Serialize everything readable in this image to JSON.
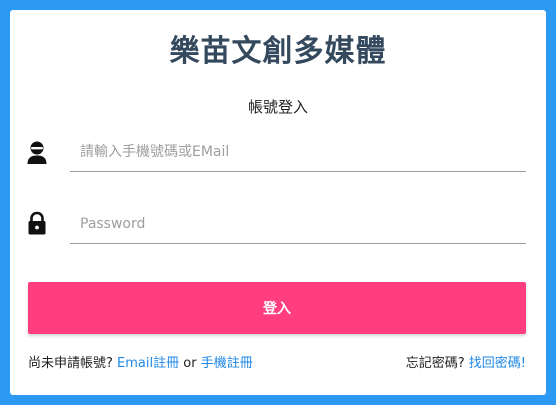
{
  "page": {
    "background_color": "#2c9af2",
    "card_color": "#ffffff"
  },
  "header": {
    "brand_title": "樂苗文創多媒體"
  },
  "login": {
    "section_title": "帳號登入",
    "account_field": {
      "icon": "user-icon",
      "value": "",
      "placeholder": "請輸入手機號碼或EMail"
    },
    "password_field": {
      "icon": "lock-icon",
      "value": "",
      "placeholder": "Password"
    },
    "submit_label": "登入",
    "submit_color": "#ff3d7f"
  },
  "footer": {
    "register_prompt": "尚未申請帳號?",
    "email_register": "Email註冊",
    "or_text": "or",
    "phone_register": "手機註冊",
    "forgot_prompt": "忘記密碼?",
    "recover_link": "找回密碼!",
    "link_color": "#1e88e5"
  }
}
